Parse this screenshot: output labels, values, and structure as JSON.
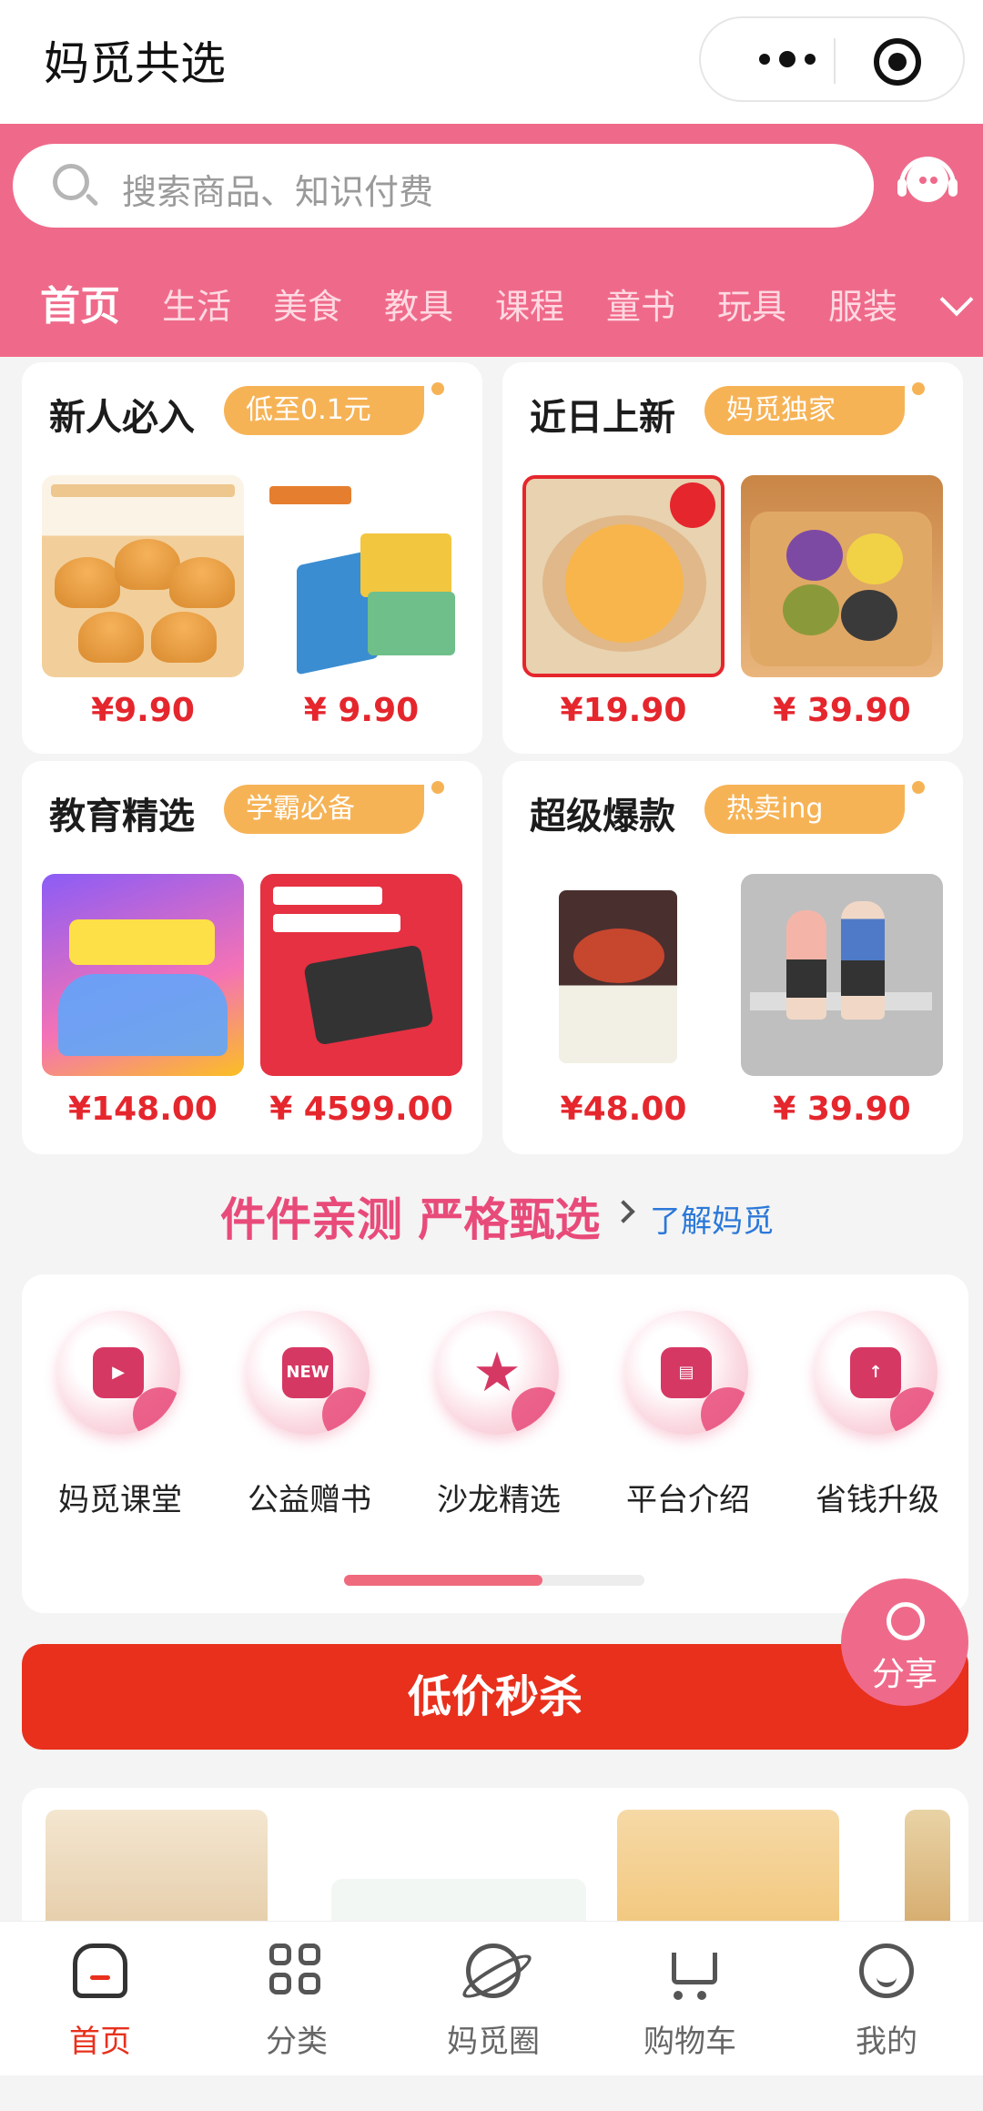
{
  "header": {
    "title": "妈觅共选",
    "more_icon": "more-dots-icon",
    "close_icon": "target-icon"
  },
  "search": {
    "placeholder": "搜索商品、知识付费",
    "icon": "search-icon",
    "service_icon": "customer-service-icon"
  },
  "tabs": [
    {
      "label": "首页",
      "active": true
    },
    {
      "label": "生活"
    },
    {
      "label": "美食"
    },
    {
      "label": "教具"
    },
    {
      "label": "课程"
    },
    {
      "label": "童书"
    },
    {
      "label": "玩具"
    },
    {
      "label": "服装"
    }
  ],
  "cards": [
    {
      "title": "新人必入",
      "tag": "低至0.1元",
      "products": [
        {
          "price": "¥9.90"
        },
        {
          "price": "¥ 9.90"
        }
      ]
    },
    {
      "title": "近日上新",
      "tag": "妈觅独家",
      "products": [
        {
          "price": "¥19.90"
        },
        {
          "price": "¥ 39.90"
        }
      ]
    },
    {
      "title": "教育精选",
      "tag": "学霸必备",
      "products": [
        {
          "price": "¥148.00"
        },
        {
          "price": "¥ 4599.00"
        }
      ]
    },
    {
      "title": "超级爆款",
      "tag": "热卖ing",
      "products": [
        {
          "price": "¥48.00"
        },
        {
          "price": "¥ 39.90"
        }
      ]
    }
  ],
  "slogan": {
    "text": "件件亲测 严格甄选",
    "link": "了解妈觅"
  },
  "shortcuts": [
    {
      "label": "妈觅课堂",
      "icon": "box-play-icon"
    },
    {
      "label": "公益赠书",
      "icon": "new-badge-icon",
      "glyph": "NEW"
    },
    {
      "label": "沙龙精选",
      "icon": "star-icon",
      "glyph": "★"
    },
    {
      "label": "平台介绍",
      "icon": "window-icon"
    },
    {
      "label": "省钱升级",
      "icon": "upgrade-icon"
    }
  ],
  "shortcut_scroll_progress": 0.66,
  "share": {
    "label": "分享",
    "icon": "share-icon"
  },
  "flash_sale": {
    "label": "低价秒杀"
  },
  "tabbar": [
    {
      "label": "首页",
      "icon": "home-icon",
      "active": true
    },
    {
      "label": "分类",
      "icon": "grid-icon"
    },
    {
      "label": "妈觅圈",
      "icon": "planet-icon"
    },
    {
      "label": "购物车",
      "icon": "cart-icon"
    },
    {
      "label": "我的",
      "icon": "smile-icon"
    }
  ],
  "colors": {
    "brand_pink": "#ef6a8a",
    "price_red": "#e5262d",
    "tag_orange": "#f6b356",
    "flash_red": "#e8301c",
    "link_blue": "#2b78d9"
  }
}
